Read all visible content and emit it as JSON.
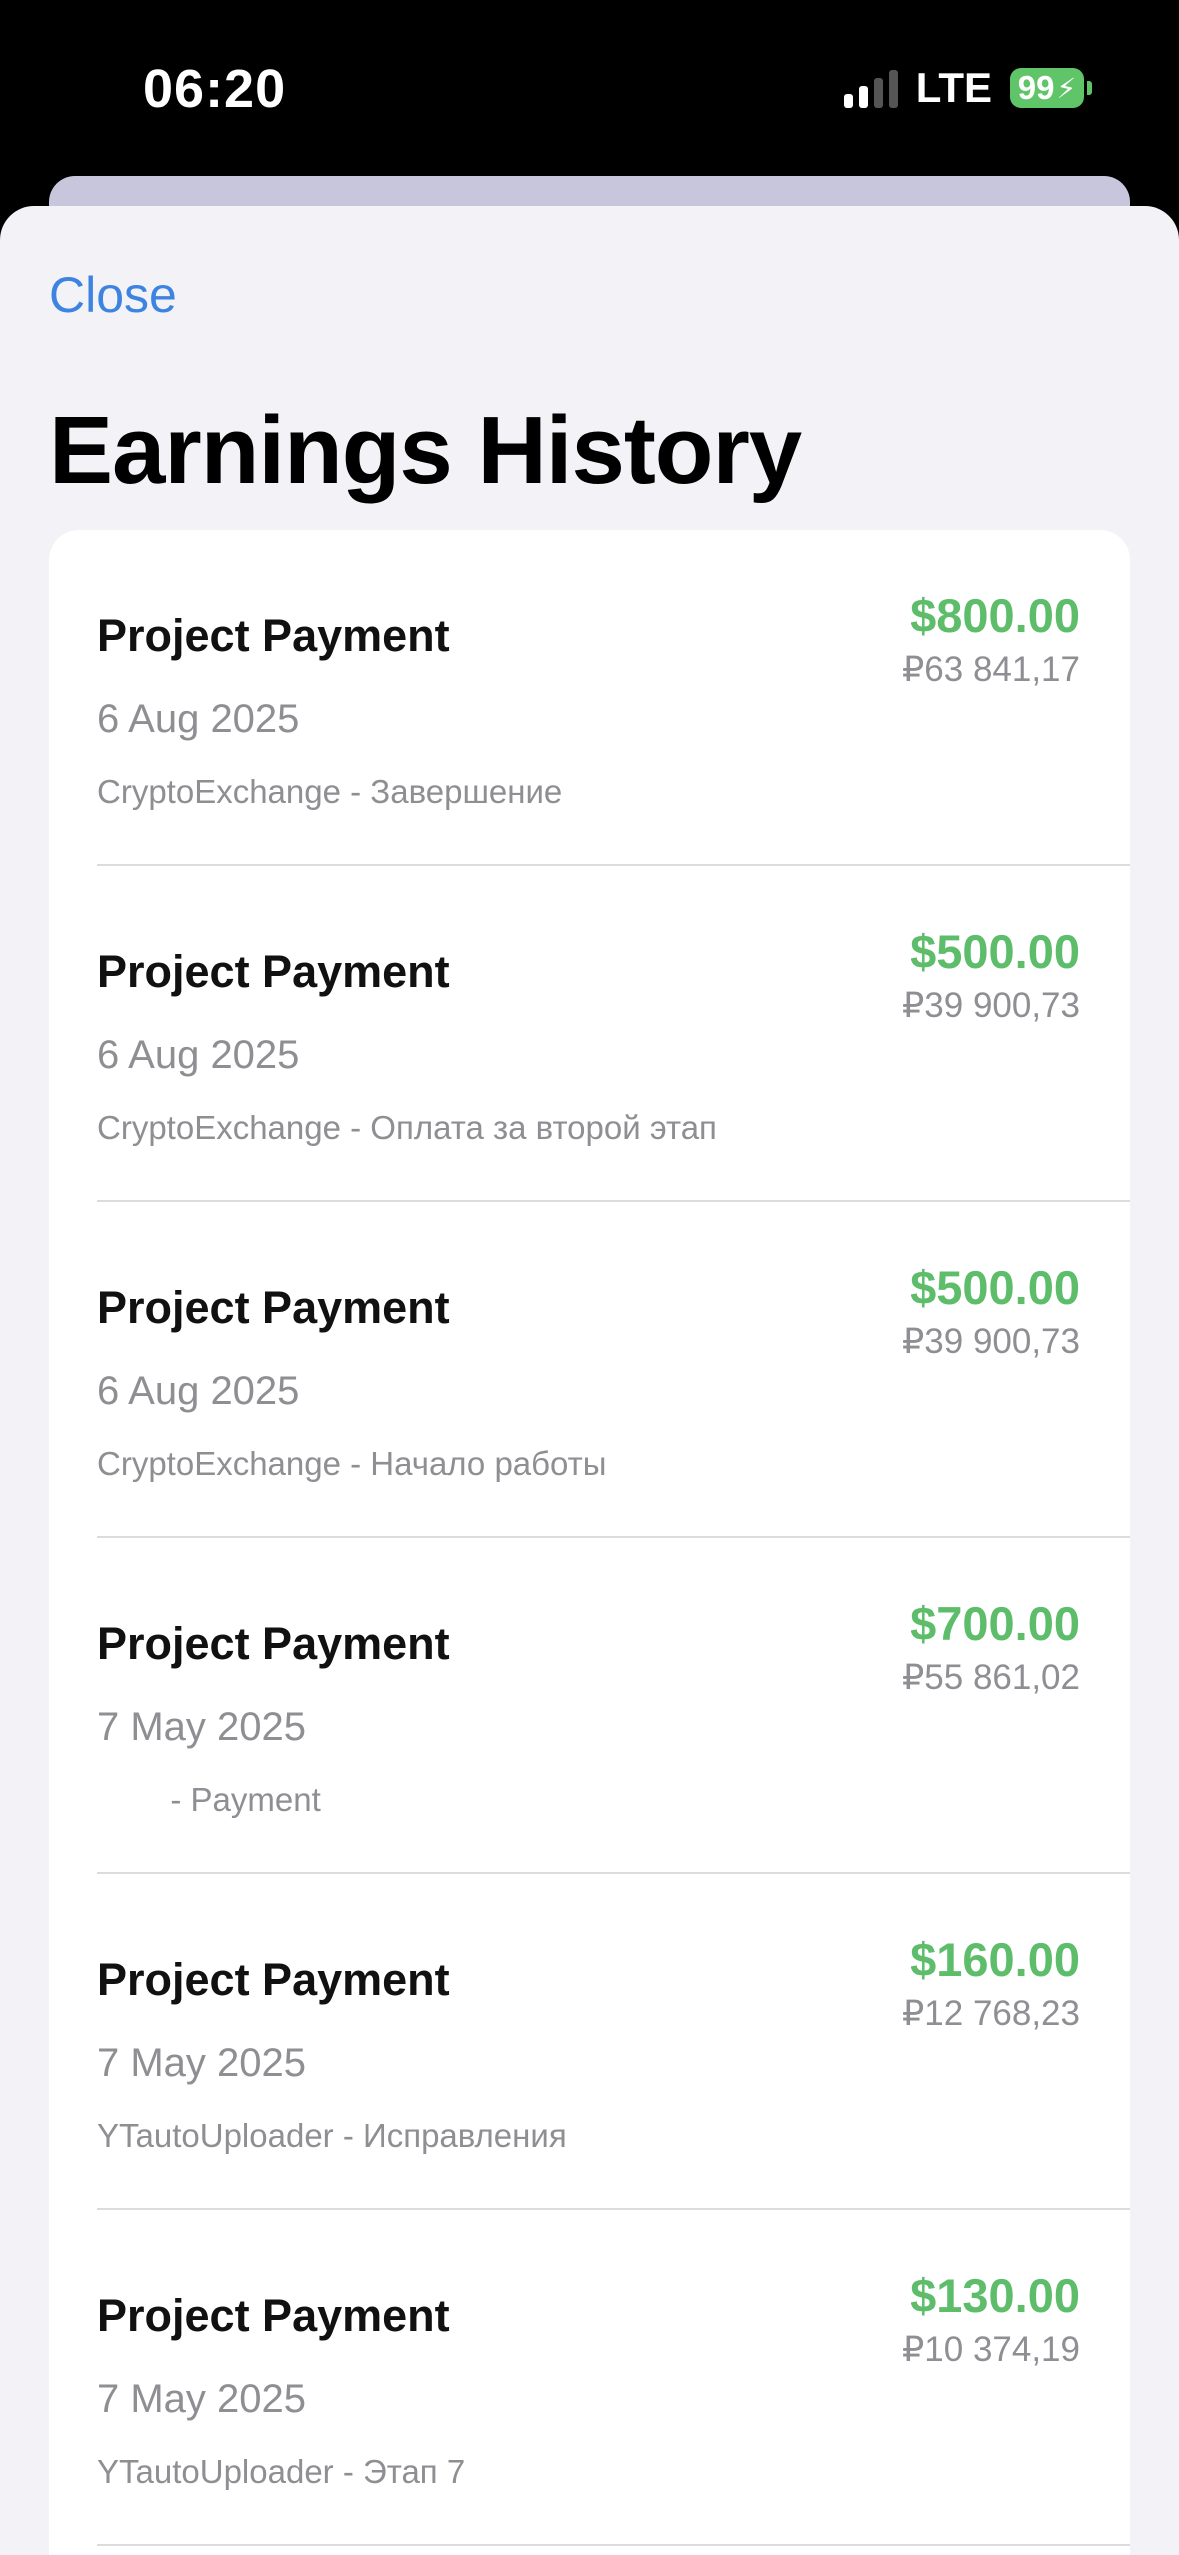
{
  "status_bar": {
    "time": "06:20",
    "network": "LTE",
    "battery": "99",
    "battery_color": "#5fc568"
  },
  "sheet": {
    "close_label": "Close",
    "title": "Earnings History",
    "accent_color": "#3d83e0",
    "amount_color": "#5ebd6b"
  },
  "payments": [
    {
      "title": "Project Payment",
      "date": "6 Aug 2025",
      "description": "CryptoExchange - Завершение",
      "usd": "$800.00",
      "rub": "₽63 841,17"
    },
    {
      "title": "Project Payment",
      "date": "6 Aug 2025",
      "description": "CryptoExchange - Оплата за второй этап",
      "usd": "$500.00",
      "rub": "₽39 900,73"
    },
    {
      "title": "Project Payment",
      "date": "6 Aug 2025",
      "description": "CryptoExchange - Начало работы",
      "usd": "$500.00",
      "rub": "₽39 900,73"
    },
    {
      "title": "Project Payment",
      "date": "7 May 2025",
      "description": "        - Payment",
      "usd": "$700.00",
      "rub": "₽55 861,02"
    },
    {
      "title": "Project Payment",
      "date": "7 May 2025",
      "description": "YTautoUploader - Исправления",
      "usd": "$160.00",
      "rub": "₽12 768,23"
    },
    {
      "title": "Project Payment",
      "date": "7 May 2025",
      "description": "YTautoUploader - Этап 7",
      "usd": "$130.00",
      "rub": "₽10 374,19"
    }
  ]
}
